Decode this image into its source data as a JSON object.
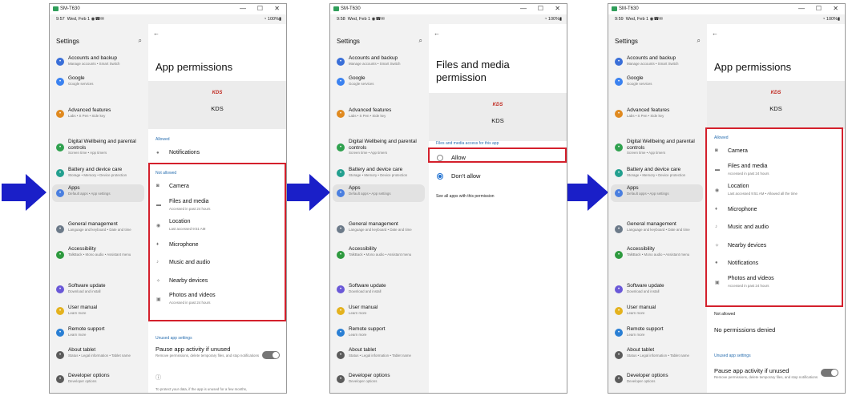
{
  "device_title": "SM-T630",
  "window_controls": {
    "minimize": "—",
    "maximize": "☐",
    "close": "✕"
  },
  "arrow_color": "#1a1fc8",
  "highlight_color": "#d4202c",
  "settings_menu": {
    "header": "Settings",
    "items": [
      {
        "title": "Accounts and backup",
        "subtitle": "Manage accounts  •  Smart Switch",
        "icon": "account-icon",
        "color": "#3a6fd8"
      },
      {
        "title": "Google",
        "subtitle": "Google services",
        "icon": "google-icon",
        "color": "#3b82f0"
      },
      {
        "title": "Advanced features",
        "subtitle": "Labs  •  S Pen  •  Side key",
        "icon": "advanced-features-icon",
        "color": "#e08a20"
      },
      {
        "title": "Digital Wellbeing and parental controls",
        "subtitle": "Screen time  •  App timers",
        "icon": "wellbeing-icon",
        "color": "#2fa14e"
      },
      {
        "title": "Battery and device care",
        "subtitle": "Storage  •  Memory  •  Device protection",
        "icon": "battery-icon",
        "color": "#23a08f"
      },
      {
        "title": "Apps",
        "subtitle": "Default apps  •  App settings",
        "icon": "apps-icon",
        "color": "#4a7fe0"
      },
      {
        "title": "General management",
        "subtitle": "Language and keyboard  •  Date and time",
        "icon": "general-management-icon",
        "color": "#6c7a89"
      },
      {
        "title": "Accessibility",
        "subtitle": "TalkBack  •  Mono audio  •  Assistant menu",
        "icon": "accessibility-icon",
        "color": "#2e9a3f"
      },
      {
        "title": "Software update",
        "subtitle": "Download and install",
        "icon": "software-update-icon",
        "color": "#6a58d8"
      },
      {
        "title": "User manual",
        "subtitle": "Learn more",
        "icon": "user-manual-icon",
        "color": "#e4b21e"
      },
      {
        "title": "Remote support",
        "subtitle": "Learn more",
        "icon": "remote-support-icon",
        "color": "#2a7fd4"
      },
      {
        "title": "About tablet",
        "subtitle": "Status  •  Legal information  •  Tablet name",
        "icon": "about-tablet-icon",
        "color": "#5b5b5b"
      },
      {
        "title": "Developer options",
        "subtitle": "Developer options",
        "icon": "developer-options-icon",
        "color": "#5b5b5b"
      }
    ]
  },
  "app": {
    "logo_text": "KDS",
    "name": "KDS"
  },
  "screens": [
    {
      "time": "9:57",
      "date": "Wed, Feb 1",
      "battery": "100%",
      "title": "App permissions",
      "sections": [
        {
          "header": "Allowed",
          "items": [
            {
              "label": "Notifications",
              "sub": "",
              "icon": "bell-icon"
            }
          ]
        },
        {
          "header": "Not allowed",
          "items": [
            {
              "label": "Camera",
              "sub": "",
              "icon": "camera-icon"
            },
            {
              "label": "Files and media",
              "sub": "Accessed in past 24 hours",
              "icon": "folder-icon"
            },
            {
              "label": "Location",
              "sub": "Last accessed 9:51 AM",
              "icon": "location-icon"
            },
            {
              "label": "Microphone",
              "sub": "",
              "icon": "microphone-icon"
            },
            {
              "label": "Music and audio",
              "sub": "",
              "icon": "music-icon"
            },
            {
              "label": "Nearby devices",
              "sub": "",
              "icon": "nearby-devices-icon"
            },
            {
              "label": "Photos and videos",
              "sub": "Accessed in past 24 hours",
              "icon": "photos-icon"
            }
          ]
        }
      ],
      "unused_header": "Unused app settings",
      "pause_title": "Pause app activity if unused",
      "pause_sub": "Remove permissions, delete temporary files, and stop notifications",
      "footer_note": "To protect your data, if the app is unused for a few months,"
    },
    {
      "time": "9:58",
      "date": "Wed, Feb 1",
      "battery": "100%",
      "title_line1": "Files and media",
      "title_line2": "permission",
      "access_header": "Files and media access for this app",
      "options": [
        {
          "label": "Allow",
          "selected": false
        },
        {
          "label": "Don't allow",
          "selected": true
        }
      ],
      "see_all": "See all apps with this permission"
    },
    {
      "time": "9:59",
      "date": "Wed, Feb 1",
      "battery": "100%",
      "title": "App permissions",
      "sections": [
        {
          "header": "Allowed",
          "items": [
            {
              "label": "Camera",
              "sub": "",
              "icon": "camera-icon"
            },
            {
              "label": "Files and media",
              "sub": "Accessed in past 24 hours",
              "icon": "folder-icon"
            },
            {
              "label": "Location",
              "sub": "Last accessed 9:51 AM  •  Allowed all the time",
              "icon": "location-icon"
            },
            {
              "label": "Microphone",
              "sub": "",
              "icon": "microphone-icon"
            },
            {
              "label": "Music and audio",
              "sub": "",
              "icon": "music-icon"
            },
            {
              "label": "Nearby devices",
              "sub": "",
              "icon": "nearby-devices-icon"
            },
            {
              "label": "Notifications",
              "sub": "",
              "icon": "bell-icon"
            },
            {
              "label": "Photos and videos",
              "sub": "Accessed in past 24 hours",
              "icon": "photos-icon"
            }
          ]
        },
        {
          "header": "Not allowed",
          "items": [
            {
              "label": "No permissions denied",
              "sub": "",
              "icon": ""
            }
          ]
        }
      ],
      "unused_header": "Unused app settings",
      "pause_title": "Pause app activity if unused",
      "pause_sub": "Remove permissions, delete temporary files, and stop notifications"
    }
  ]
}
